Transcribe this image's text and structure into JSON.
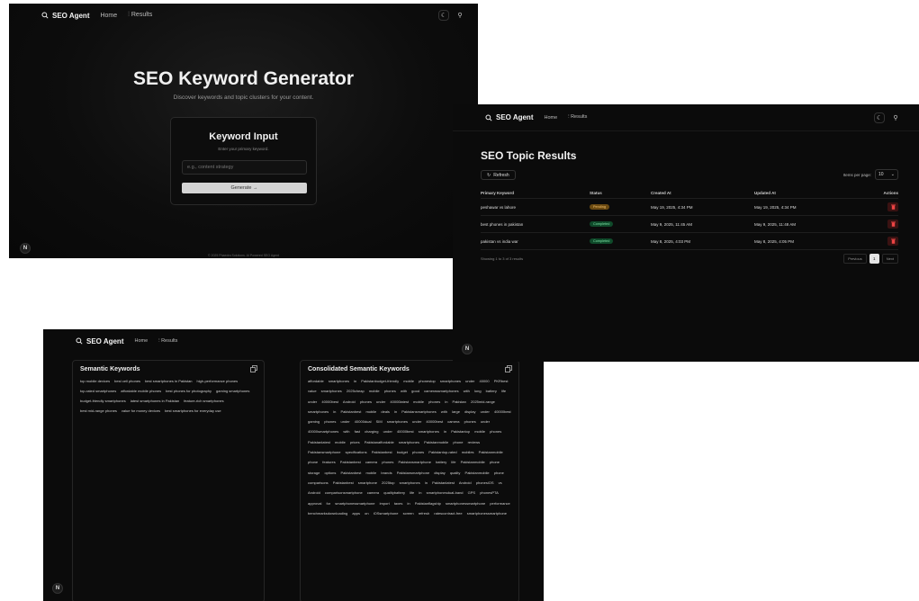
{
  "brand": {
    "name": "SEO Agent"
  },
  "nav": {
    "home": "Home",
    "results": "Results"
  },
  "generator": {
    "title": "SEO Keyword Generator",
    "subtitle": "Discover keywords and topic clusters for your content.",
    "card_title": "Keyword Input",
    "card_subtitle": "Enter your primary keyword.",
    "input_placeholder": "e.g., content strategy",
    "generate_label": "Generate →",
    "footer": "© 2025 Phaedra Solutions. AI Powered SEO Agent"
  },
  "results": {
    "title": "SEO Topic Results",
    "refresh_label": "Refresh",
    "items_per_page_label": "Items per page:",
    "items_per_page_value": "10",
    "columns": [
      "Primary Keyword",
      "Status",
      "Created At",
      "Updated At",
      "Actions"
    ],
    "rows": [
      {
        "keyword": "peshawar vs lahore",
        "status": "Pending",
        "created": "May 19, 2025, 4:34 PM",
        "updated": "May 19, 2025, 4:34 PM"
      },
      {
        "keyword": "best phones in pakistan",
        "status": "Completed",
        "created": "May 9, 2025, 11:45 AM",
        "updated": "May 9, 2025, 11:48 AM"
      },
      {
        "keyword": "pakistan vs india war",
        "status": "Completed",
        "created": "May 8, 2025, 4:03 PM",
        "updated": "May 8, 2025, 4:05 PM"
      }
    ],
    "showing": "Showing 1 to 3 of 3 results",
    "previous": "Previous",
    "page": "1",
    "next": "Next"
  },
  "semantic": {
    "title": "Semantic Keywords",
    "chips": [
      "top mobile devices",
      "best cell phones",
      "best smartphones in Pakistan",
      "high-performance phones",
      "top-rated smartphones",
      "affordable mobile phones",
      "best phones for photography",
      "gaming smartphones",
      "budget-friendly smartphones",
      "latest smartphones in Pakistan",
      "feature-rich smartphones",
      "best mid-range phones",
      "value for money devices",
      "best smartphones for everyday use"
    ]
  },
  "consolidated": {
    "title": "Consolidated Semantic Keywords",
    "text": "affordable smartphones in Pakistanbudget-friendly mobile phonestop smartphones under 40000 PKRbest value smartphones 2025cheap mobile phones with good camerassmartphones with long battery life under 40000best Android phones under 40000latest mobile phones in Pakistan 2025mid-range smartphones in Pakistanbest mobile deals in Pakistansmartphones with large display under 40000best gaming phones under 40000dual SIM smartphones under 40000best camera phones under 40000smartphones with fast charging under 40000best smartphones in Pakistantop mobile phones Pakistanlatest mobile prices Pakistanaffordable smartphones Pakistanmobile phone reviews Pakistansmartphone specifications Pakistanbest budget phones Pakistantop-rated mobiles Pakistanmobile phone features Pakistanbest camera phones Pakistansmartphone battery life Pakistanmobile phone storage options Pakistanbest mobile brands Pakistansmartphone display quality Pakistanmobile phone comparisons Pakistanbest smartphone 2025top smartphones in Pakistanlatest Android phonesiOS vs Android comparisonsmartphone camera qualitybattery life in smartphonesdual-band GPS phonesPTA approval for smartphonessmartphone import taxes in Pakistanflagship smartphonessmartphone performance benchmarksdownloading apps on iOSsmartphone screen refresh ratescontract-free smartphonessmartphone"
  },
  "colors": {
    "pending": "#6b4a12",
    "completed": "#0f4a2a",
    "delete": "#3a1212"
  }
}
